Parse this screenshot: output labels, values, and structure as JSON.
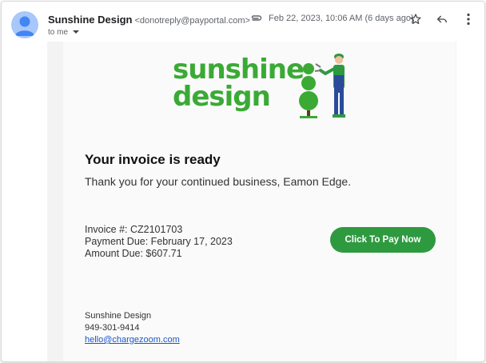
{
  "header": {
    "sender_name": "Sunshine Design",
    "sender_email": "<donotreply@payportal.com>",
    "recipient": "to me",
    "date": "Feb 22, 2023, 10:06 AM (6 days ago)",
    "icons": [
      "avatar-icon",
      "attachment-icon",
      "star-icon",
      "reply-icon",
      "more-vert-icon"
    ]
  },
  "logo": {
    "line1": "sunshine",
    "line2": "design",
    "color": "#3aaa35"
  },
  "email": {
    "title": "Your invoice is ready",
    "thanks": "Thank you for your continued business, Eamon Edge.",
    "invoice_number": "Invoice #: CZ2101703",
    "payment_due": "Payment Due: February 17, 2023",
    "amount_due": "Amount Due: $607.71",
    "pay_button": "Click To Pay Now",
    "accent": "#2e9a3f"
  },
  "footer": {
    "company": "Sunshine Design",
    "phone": "949-301-9414",
    "email": "hello@chargezoom.com"
  }
}
